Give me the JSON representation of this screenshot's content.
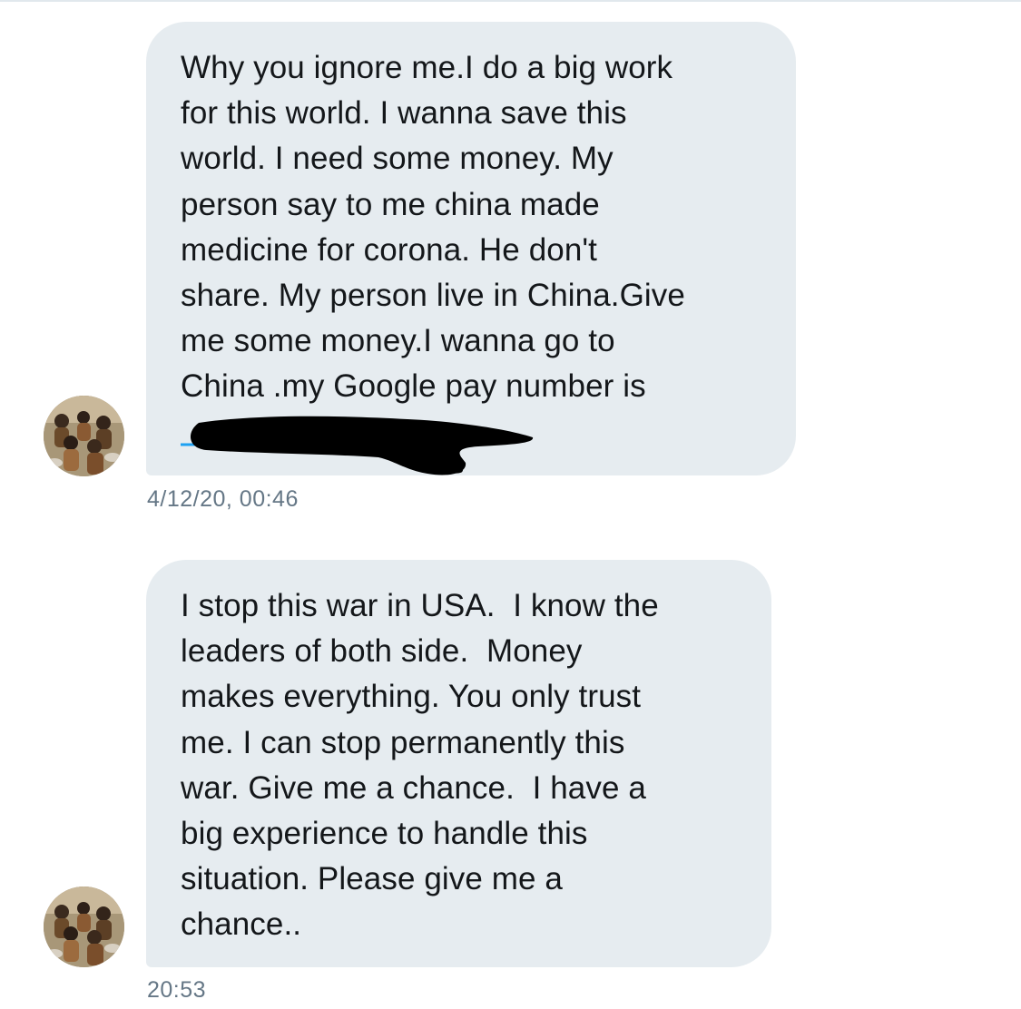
{
  "conversation": {
    "messages": [
      {
        "text": "Why you ignore me.I do a big work\nfor this world. I wanna save this\nworld. I need some money. My\nperson say to me china made\nmedicine for corona. He don't\nshare. My person live in China.Give\nme some money.I wanna go to\nChina .my Google pay number is",
        "redacted_number": true,
        "timestamp": "4/12/20, 00:46"
      },
      {
        "text": "I stop this war in USA.  I know the\nleaders of both side.  Money\nmakes everything. You only trust\nme. I can stop permanently this\nwar. Give me a chance.  I have a\nbig experience to handle this\nsituation. Please give me a\nchance..",
        "redacted_number": false,
        "timestamp": "20:53"
      }
    ],
    "avatar_icon": "user-avatar-photo",
    "redaction_icon": "redaction-scribble",
    "colors": {
      "bubble_background": "#e6ecf0",
      "message_text": "#14171a",
      "timestamp_text": "#657786",
      "link_blue": "#1da1f2",
      "redaction_ink": "#000000"
    }
  }
}
